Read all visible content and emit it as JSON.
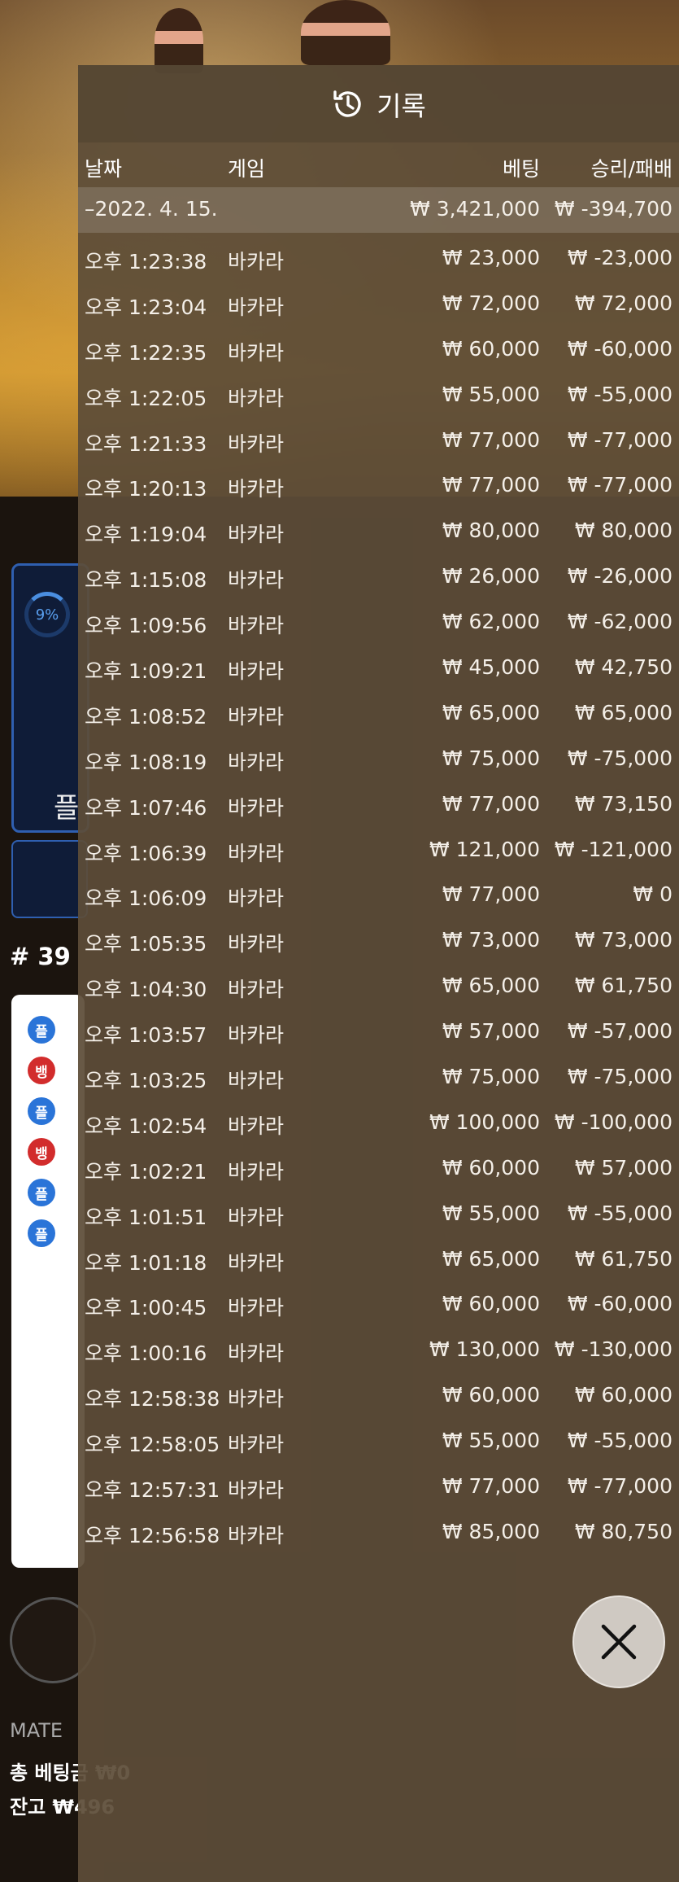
{
  "modal": {
    "title": "기록",
    "columns": {
      "date": "날짜",
      "game": "게임",
      "bet": "베팅",
      "result": "승리/패배"
    },
    "summary": {
      "date": "–2022. 4. 15.",
      "bet": "₩ 3,421,000",
      "result": "₩ -394,700"
    },
    "rows": [
      {
        "time": "오후 1:23:38",
        "game": "바카라",
        "bet": "₩ 23,000",
        "result": "₩ -23,000"
      },
      {
        "time": "오후 1:23:04",
        "game": "바카라",
        "bet": "₩ 72,000",
        "result": "₩ 72,000"
      },
      {
        "time": "오후 1:22:35",
        "game": "바카라",
        "bet": "₩ 60,000",
        "result": "₩ -60,000"
      },
      {
        "time": "오후 1:22:05",
        "game": "바카라",
        "bet": "₩ 55,000",
        "result": "₩ -55,000"
      },
      {
        "time": "오후 1:21:33",
        "game": "바카라",
        "bet": "₩ 77,000",
        "result": "₩ -77,000"
      },
      {
        "time": "오후 1:20:13",
        "game": "바카라",
        "bet": "₩ 77,000",
        "result": "₩ -77,000"
      },
      {
        "time": "오후 1:19:04",
        "game": "바카라",
        "bet": "₩ 80,000",
        "result": "₩ 80,000"
      },
      {
        "time": "오후 1:15:08",
        "game": "바카라",
        "bet": "₩ 26,000",
        "result": "₩ -26,000"
      },
      {
        "time": "오후 1:09:56",
        "game": "바카라",
        "bet": "₩ 62,000",
        "result": "₩ -62,000"
      },
      {
        "time": "오후 1:09:21",
        "game": "바카라",
        "bet": "₩ 45,000",
        "result": "₩ 42,750"
      },
      {
        "time": "오후 1:08:52",
        "game": "바카라",
        "bet": "₩ 65,000",
        "result": "₩ 65,000"
      },
      {
        "time": "오후 1:08:19",
        "game": "바카라",
        "bet": "₩ 75,000",
        "result": "₩ -75,000"
      },
      {
        "time": "오후 1:07:46",
        "game": "바카라",
        "bet": "₩ 77,000",
        "result": "₩ 73,150"
      },
      {
        "time": "오후 1:06:39",
        "game": "바카라",
        "bet": "₩ 121,000",
        "result": "₩ -121,000"
      },
      {
        "time": "오후 1:06:09",
        "game": "바카라",
        "bet": "₩ 77,000",
        "result": "₩ 0"
      },
      {
        "time": "오후 1:05:35",
        "game": "바카라",
        "bet": "₩ 73,000",
        "result": "₩ 73,000"
      },
      {
        "time": "오후 1:04:30",
        "game": "바카라",
        "bet": "₩ 65,000",
        "result": "₩ 61,750"
      },
      {
        "time": "오후 1:03:57",
        "game": "바카라",
        "bet": "₩ 57,000",
        "result": "₩ -57,000"
      },
      {
        "time": "오후 1:03:25",
        "game": "바카라",
        "bet": "₩ 75,000",
        "result": "₩ -75,000"
      },
      {
        "time": "오후 1:02:54",
        "game": "바카라",
        "bet": "₩ 100,000",
        "result": "₩ -100,000"
      },
      {
        "time": "오후 1:02:21",
        "game": "바카라",
        "bet": "₩ 60,000",
        "result": "₩ 57,000"
      },
      {
        "time": "오후 1:01:51",
        "game": "바카라",
        "bet": "₩ 55,000",
        "result": "₩ -55,000"
      },
      {
        "time": "오후 1:01:18",
        "game": "바카라",
        "bet": "₩ 65,000",
        "result": "₩ 61,750"
      },
      {
        "time": "오후 1:00:45",
        "game": "바카라",
        "bet": "₩ 60,000",
        "result": "₩ -60,000"
      },
      {
        "time": "오후 1:00:16",
        "game": "바카라",
        "bet": "₩ 130,000",
        "result": "₩ -130,000"
      },
      {
        "time": "오후 12:58:38",
        "game": "바카라",
        "bet": "₩ 60,000",
        "result": "₩ 60,000"
      },
      {
        "time": "오후 12:58:05",
        "game": "바카라",
        "bet": "₩ 55,000",
        "result": "₩ -55,000"
      },
      {
        "time": "오후 12:57:31",
        "game": "바카라",
        "bet": "₩ 77,000",
        "result": "₩ -77,000"
      },
      {
        "time": "오후 12:56:58",
        "game": "바카라",
        "bet": "₩ 85,000",
        "result": "₩ 80,750"
      }
    ]
  },
  "background": {
    "percent": "9%",
    "round": "# 39",
    "player_label": "플",
    "bank_label": "뱅",
    "total_bet": "총 베팅금 ₩0",
    "balance": "잔고 ₩496",
    "mate_line": "MATE"
  },
  "icons": {
    "header": "history-icon",
    "close": "close-icon"
  },
  "colors": {
    "modal_bg": "#5c4c38",
    "player": "#2a74d8",
    "banker": "#d22c2c"
  }
}
